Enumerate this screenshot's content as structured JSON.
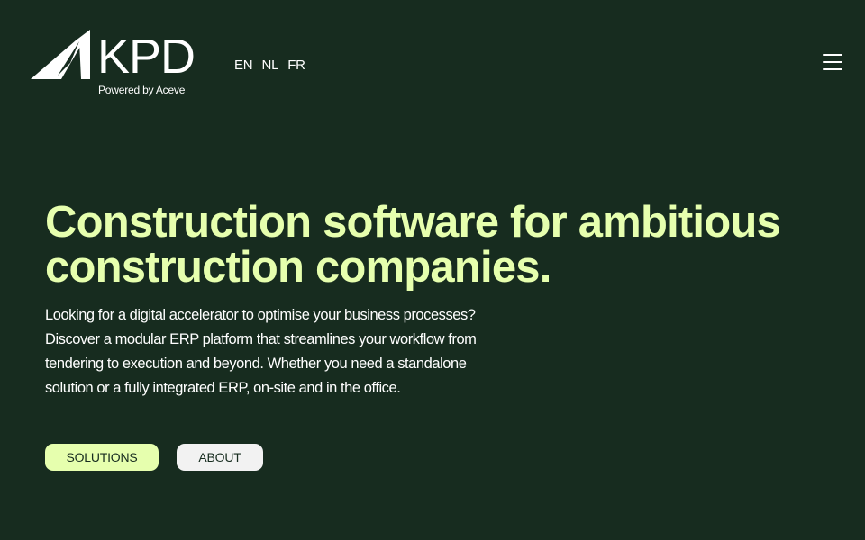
{
  "header": {
    "logo_text": "KPD",
    "logo_tagline": "Powered by Aceve",
    "languages": [
      "EN",
      "NL",
      "FR"
    ],
    "menu_icon": "hamburger-menu-icon"
  },
  "hero": {
    "title_line1": "Construction software for ambitious",
    "title_line2": "construction companies.",
    "intro": "Looking for a digital accelerator to optimise your business processes?",
    "body": "Discover a modular ERP platform that streamlines your workflow from tendering to execution and beyond. Whether you need a standalone solution or a fully integrated ERP, on-site and in the office."
  },
  "actions": {
    "solutions_label": "SOLUTIONS",
    "about_label": "ABOUT"
  },
  "colors": {
    "background": "#172c1f",
    "accent": "#e6ffae",
    "text": "#ffffff",
    "secondary_button": "#f2f2f2"
  }
}
